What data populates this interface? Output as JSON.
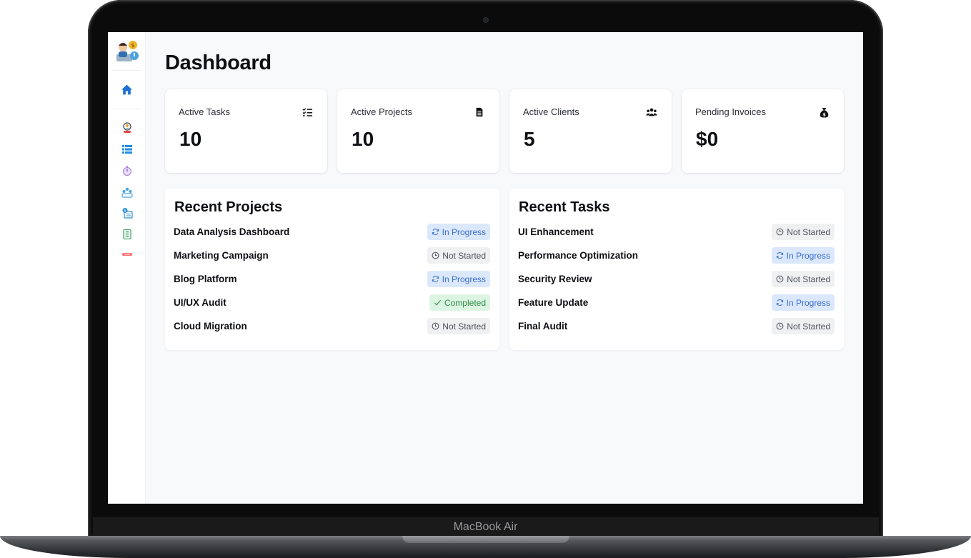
{
  "device": {
    "model_label": "MacBook Air"
  },
  "sidebar": {
    "logo_icon": "team-avatar-logo",
    "items": [
      {
        "icon": "home-icon",
        "active": true
      },
      {
        "icon": "profile-badge-icon"
      },
      {
        "icon": "list-icon"
      },
      {
        "icon": "timer-icon"
      },
      {
        "icon": "team-icon"
      },
      {
        "icon": "invoice-card-icon"
      },
      {
        "icon": "document-icon"
      },
      {
        "icon": "logout-icon"
      }
    ]
  },
  "page": {
    "title": "Dashboard"
  },
  "stats": [
    {
      "label": "Active Tasks",
      "value": "10",
      "icon": "checklist-icon"
    },
    {
      "label": "Active Projects",
      "value": "10",
      "icon": "file-icon"
    },
    {
      "label": "Active Clients",
      "value": "5",
      "icon": "users-icon"
    },
    {
      "label": "Pending Invoices",
      "value": "$0",
      "icon": "money-bag-icon"
    }
  ],
  "recent_projects": {
    "title": "Recent Projects",
    "items": [
      {
        "name": "Data Analysis Dashboard",
        "status": "In Progress"
      },
      {
        "name": "Marketing Campaign",
        "status": "Not Started"
      },
      {
        "name": "Blog Platform",
        "status": "In Progress"
      },
      {
        "name": "UI/UX Audit",
        "status": "Completed"
      },
      {
        "name": "Cloud Migration",
        "status": "Not Started"
      }
    ]
  },
  "recent_tasks": {
    "title": "Recent Tasks",
    "items": [
      {
        "name": "UI Enhancement",
        "status": "Not Started"
      },
      {
        "name": "Performance Optimization",
        "status": "In Progress"
      },
      {
        "name": "Security Review",
        "status": "Not Started"
      },
      {
        "name": "Feature Update",
        "status": "In Progress"
      },
      {
        "name": "Final Audit",
        "status": "Not Started"
      }
    ]
  },
  "colors": {
    "accent": "#1f6fd6",
    "in_progress_bg": "#dbe8fb",
    "not_started_bg": "#eef0f2",
    "completed_bg": "#dcf5e2"
  }
}
